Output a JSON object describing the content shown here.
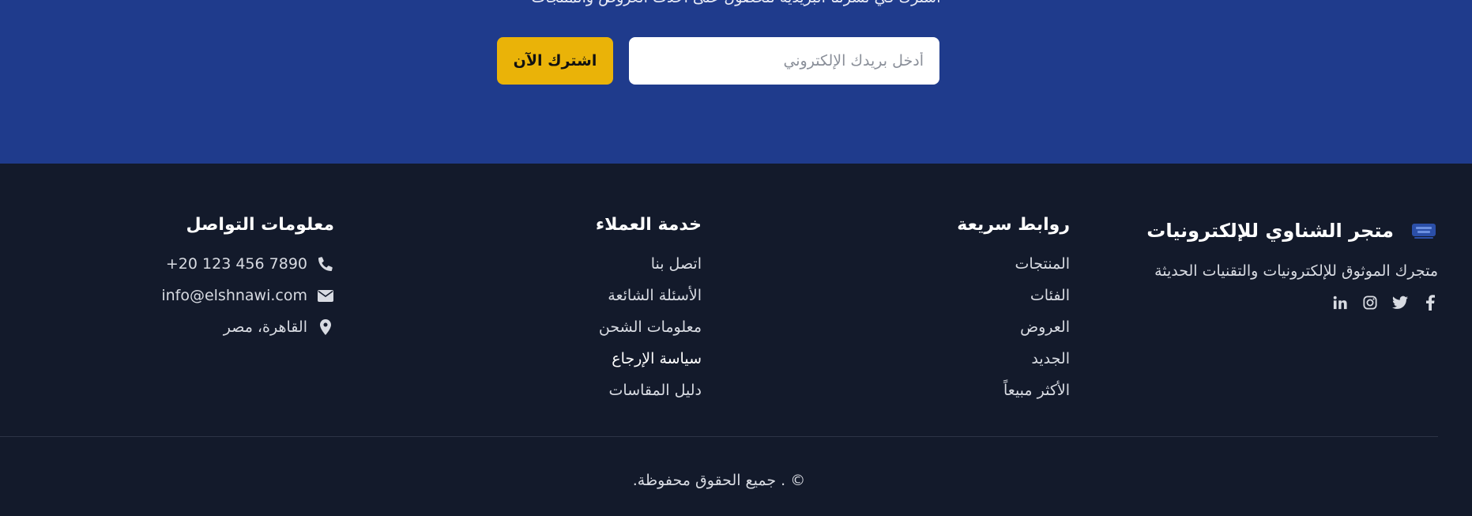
{
  "newsletter": {
    "subtitle": "اشترك في نشرتنا البريدية للحصول على أحدث العروض والمنتجات",
    "email_placeholder": "أدخل بريدك الإلكتروني",
    "subscribe_label": "اشترك الآن",
    "bg_color": "#1f3b8c",
    "button_color": "#eab308"
  },
  "brand": {
    "title": "متجر الشناوي للإلكترونيات",
    "tagline": "متجرك الموثوق للإلكترونيات والتقنيات الحديثة",
    "socials": [
      "facebook-icon",
      "twitter-icon",
      "instagram-icon",
      "linkedin-icon"
    ]
  },
  "quick_links": {
    "title": "روابط سريعة",
    "items": [
      "المنتجات",
      "الفئات",
      "العروض",
      "الجديد",
      "الأكثر مبيعاً"
    ]
  },
  "customer_service": {
    "title": "خدمة العملاء",
    "items": [
      "اتصل بنا",
      "الأسئلة الشائعة",
      "معلومات الشحن",
      "سياسة الإرجاع",
      "دليل المقاسات"
    ]
  },
  "contact": {
    "title": "معلومات التواصل",
    "phone": "+20 123 456 7890",
    "email": "info@elshnawi.com",
    "address": "القاهرة، مصر"
  },
  "copyright": "© . جميع الحقوق محفوظة.",
  "footer_bg": "#131a2b"
}
